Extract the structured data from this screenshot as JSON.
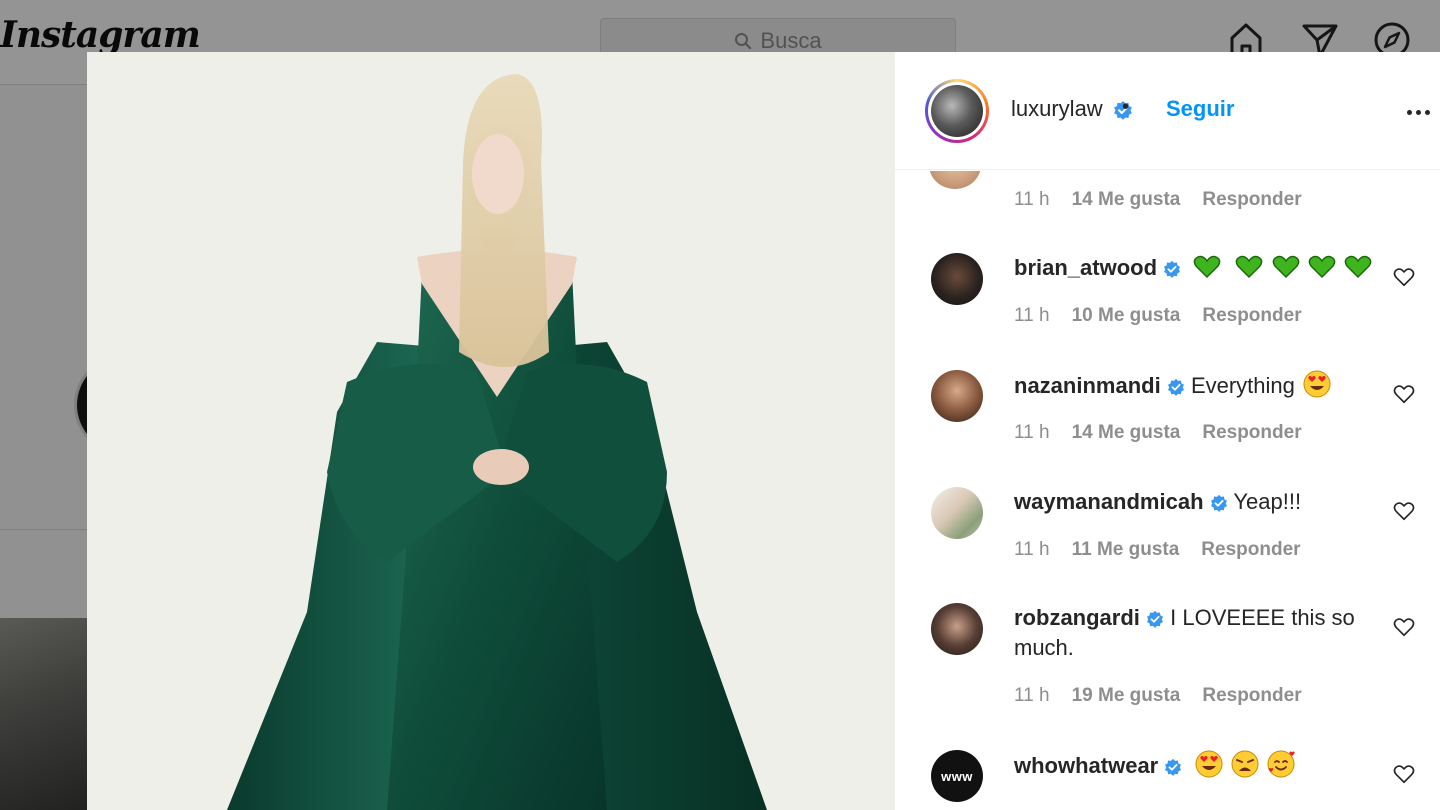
{
  "app": {
    "logo": "Instagram",
    "search_placeholder": "Busca"
  },
  "post": {
    "owner_username": "luxurylaw",
    "separator": "•",
    "follow_label": "Seguir",
    "more_options_icon": "ellipsis-icon"
  },
  "first_meta": {
    "time": "11 h",
    "likes": "14 Me gusta",
    "reply": "Responder"
  },
  "comments": [
    {
      "username": "brian_atwood",
      "text": "",
      "emoji": [
        "green-heart-emoji",
        "green-heart-emoji",
        "green-heart-emoji",
        "green-heart-emoji",
        "green-heart-emoji"
      ],
      "time": "11 h",
      "likes": "10 Me gusta",
      "reply": "Responder"
    },
    {
      "username": "nazaninmandi",
      "text": "Everything",
      "emoji": [
        "heart-eyes-emoji"
      ],
      "time": "11 h",
      "likes": "14 Me gusta",
      "reply": "Responder"
    },
    {
      "username": "waymanandmicah",
      "text": "Yeap!!!",
      "emoji": [],
      "time": "11 h",
      "likes": "11 Me gusta",
      "reply": "Responder"
    },
    {
      "username": "robzangardi",
      "text": "I LOVEEEE this so much.",
      "emoji": [],
      "time": "11 h",
      "likes": "19 Me gusta",
      "reply": "Responder"
    },
    {
      "username": "whowhatwear",
      "text": "",
      "avatar_label": "www",
      "emoji": [
        "heart-eyes-emoji",
        "weary-face-emoji",
        "smiling-hearts-emoji"
      ]
    }
  ],
  "colors": {
    "accent_blue": "#0095f6",
    "verified_blue": "#3897f0",
    "dress_green": "#0f4d3a"
  }
}
